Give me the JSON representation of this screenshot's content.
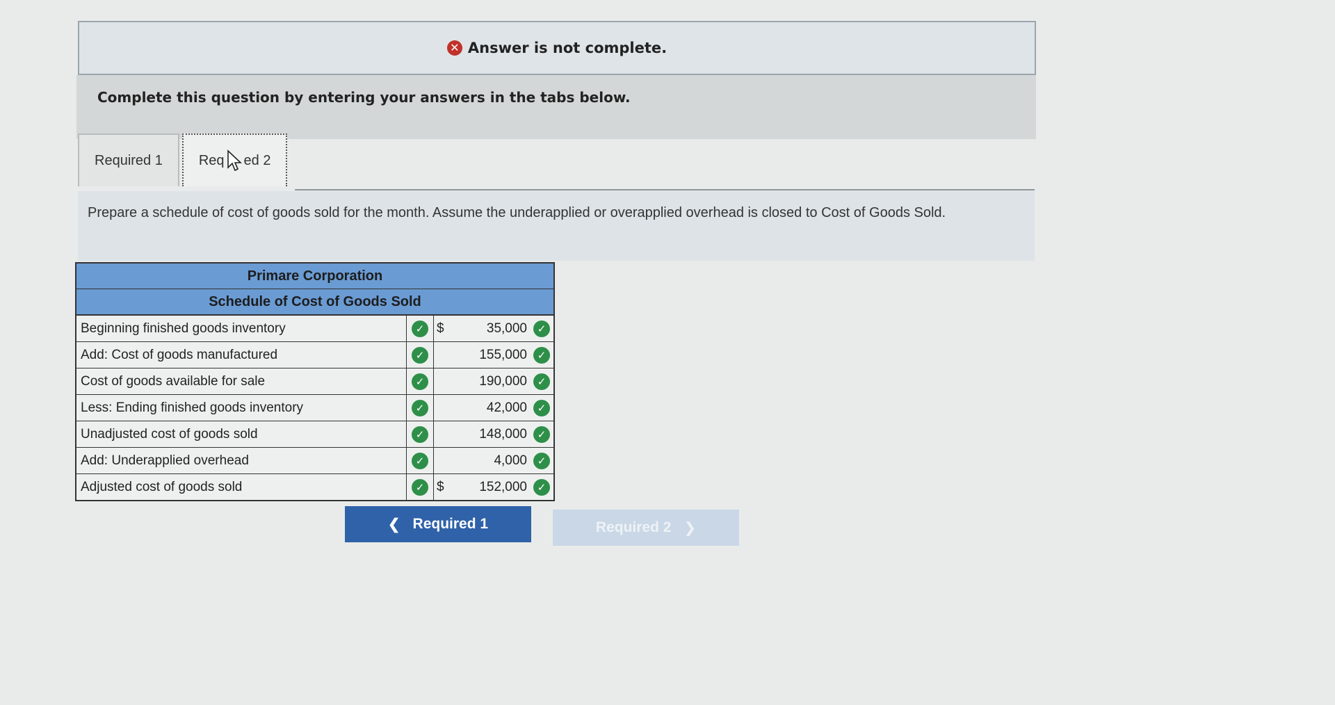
{
  "banner": {
    "text": "Answer is not complete.",
    "icon": "x-circle-icon",
    "color": "#c0312a"
  },
  "instructions": "Complete this question by entering your answers in the tabs below.",
  "tabs": [
    {
      "label": "Required 1"
    },
    {
      "label_start": "Req",
      "label_end": "ed 2"
    }
  ],
  "question": "Prepare a schedule of cost of goods sold for the month. Assume the underapplied or overapplied overhead is closed to Cost of Goods Sold.",
  "schedule": {
    "company": "Primare Corporation",
    "title": "Schedule of Cost of Goods Sold",
    "rows": [
      {
        "label": "Beginning finished goods inventory",
        "currency": "$",
        "value": "35,000"
      },
      {
        "label": "Add: Cost of goods manufactured",
        "currency": "",
        "value": "155,000"
      },
      {
        "label": "Cost of goods available for sale",
        "currency": "",
        "value": "190,000"
      },
      {
        "label": "Less: Ending finished goods inventory",
        "currency": "",
        "value": "42,000"
      },
      {
        "label": "Unadjusted cost of goods sold",
        "currency": "",
        "value": "148,000"
      },
      {
        "label": "Add: Underapplied overhead",
        "currency": "",
        "value": "4,000"
      },
      {
        "label": "Adjusted cost of goods sold",
        "currency": "$",
        "value": "152,000"
      }
    ]
  },
  "nav": {
    "prev_label": "Required 1",
    "next_label": "Required 2"
  },
  "colors": {
    "header_blue": "#6a9bd3",
    "check_green": "#2e8f49",
    "button_blue": "#2f62a8"
  }
}
